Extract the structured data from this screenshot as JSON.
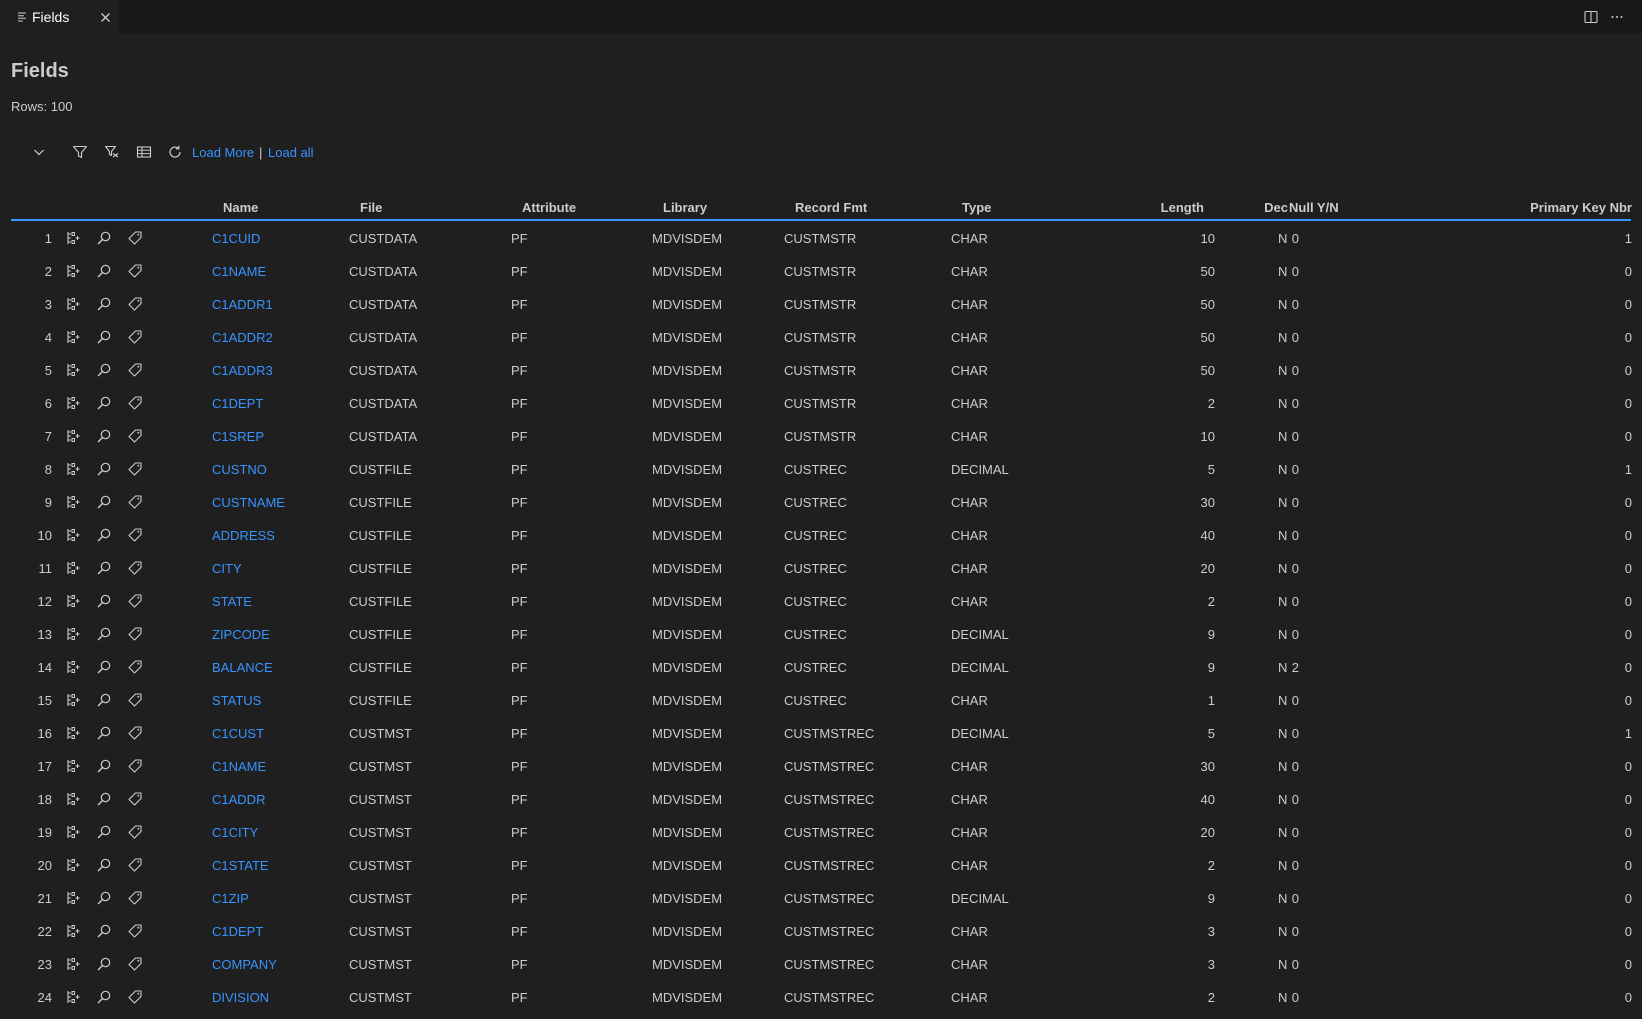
{
  "tab": {
    "label": "Fields"
  },
  "page": {
    "title": "Fields",
    "rows_label": "Rows: 100"
  },
  "toolbar": {
    "load_more": "Load More",
    "separator": "|",
    "load_all": "Load all"
  },
  "columns": {
    "name": "Name",
    "file": "File",
    "attribute": "Attribute",
    "library": "Library",
    "record_fmt": "Record Fmt",
    "type": "Type",
    "length": "Length",
    "dec": "Dec",
    "null_yn": "Null Y/N",
    "primary_key_nbr": "Primary Key Nbr"
  },
  "rows": [
    {
      "n": "1",
      "name": "C1CUID",
      "file": "CUSTDATA",
      "attr": "PF",
      "lib": "MDVISDEM",
      "fmt": "CUSTMSTR",
      "type": "CHAR",
      "len": "10",
      "dec": "0",
      "nul": "N",
      "pk": "1"
    },
    {
      "n": "2",
      "name": "C1NAME",
      "file": "CUSTDATA",
      "attr": "PF",
      "lib": "MDVISDEM",
      "fmt": "CUSTMSTR",
      "type": "CHAR",
      "len": "50",
      "dec": "0",
      "nul": "N",
      "pk": "0"
    },
    {
      "n": "3",
      "name": "C1ADDR1",
      "file": "CUSTDATA",
      "attr": "PF",
      "lib": "MDVISDEM",
      "fmt": "CUSTMSTR",
      "type": "CHAR",
      "len": "50",
      "dec": "0",
      "nul": "N",
      "pk": "0"
    },
    {
      "n": "4",
      "name": "C1ADDR2",
      "file": "CUSTDATA",
      "attr": "PF",
      "lib": "MDVISDEM",
      "fmt": "CUSTMSTR",
      "type": "CHAR",
      "len": "50",
      "dec": "0",
      "nul": "N",
      "pk": "0"
    },
    {
      "n": "5",
      "name": "C1ADDR3",
      "file": "CUSTDATA",
      "attr": "PF",
      "lib": "MDVISDEM",
      "fmt": "CUSTMSTR",
      "type": "CHAR",
      "len": "50",
      "dec": "0",
      "nul": "N",
      "pk": "0"
    },
    {
      "n": "6",
      "name": "C1DEPT",
      "file": "CUSTDATA",
      "attr": "PF",
      "lib": "MDVISDEM",
      "fmt": "CUSTMSTR",
      "type": "CHAR",
      "len": "2",
      "dec": "0",
      "nul": "N",
      "pk": "0"
    },
    {
      "n": "7",
      "name": "C1SREP",
      "file": "CUSTDATA",
      "attr": "PF",
      "lib": "MDVISDEM",
      "fmt": "CUSTMSTR",
      "type": "CHAR",
      "len": "10",
      "dec": "0",
      "nul": "N",
      "pk": "0"
    },
    {
      "n": "8",
      "name": "CUSTNO",
      "file": "CUSTFILE",
      "attr": "PF",
      "lib": "MDVISDEM",
      "fmt": "CUSTREC",
      "type": "DECIMAL",
      "len": "5",
      "dec": "0",
      "nul": "N",
      "pk": "1"
    },
    {
      "n": "9",
      "name": "CUSTNAME",
      "file": "CUSTFILE",
      "attr": "PF",
      "lib": "MDVISDEM",
      "fmt": "CUSTREC",
      "type": "CHAR",
      "len": "30",
      "dec": "0",
      "nul": "N",
      "pk": "0"
    },
    {
      "n": "10",
      "name": "ADDRESS",
      "file": "CUSTFILE",
      "attr": "PF",
      "lib": "MDVISDEM",
      "fmt": "CUSTREC",
      "type": "CHAR",
      "len": "40",
      "dec": "0",
      "nul": "N",
      "pk": "0"
    },
    {
      "n": "11",
      "name": "CITY",
      "file": "CUSTFILE",
      "attr": "PF",
      "lib": "MDVISDEM",
      "fmt": "CUSTREC",
      "type": "CHAR",
      "len": "20",
      "dec": "0",
      "nul": "N",
      "pk": "0"
    },
    {
      "n": "12",
      "name": "STATE",
      "file": "CUSTFILE",
      "attr": "PF",
      "lib": "MDVISDEM",
      "fmt": "CUSTREC",
      "type": "CHAR",
      "len": "2",
      "dec": "0",
      "nul": "N",
      "pk": "0"
    },
    {
      "n": "13",
      "name": "ZIPCODE",
      "file": "CUSTFILE",
      "attr": "PF",
      "lib": "MDVISDEM",
      "fmt": "CUSTREC",
      "type": "DECIMAL",
      "len": "9",
      "dec": "0",
      "nul": "N",
      "pk": "0"
    },
    {
      "n": "14",
      "name": "BALANCE",
      "file": "CUSTFILE",
      "attr": "PF",
      "lib": "MDVISDEM",
      "fmt": "CUSTREC",
      "type": "DECIMAL",
      "len": "9",
      "dec": "2",
      "nul": "N",
      "pk": "0"
    },
    {
      "n": "15",
      "name": "STATUS",
      "file": "CUSTFILE",
      "attr": "PF",
      "lib": "MDVISDEM",
      "fmt": "CUSTREC",
      "type": "CHAR",
      "len": "1",
      "dec": "0",
      "nul": "N",
      "pk": "0"
    },
    {
      "n": "16",
      "name": "C1CUST",
      "file": "CUSTMST",
      "attr": "PF",
      "lib": "MDVISDEM",
      "fmt": "CUSTMSTREC",
      "type": "DECIMAL",
      "len": "5",
      "dec": "0",
      "nul": "N",
      "pk": "1"
    },
    {
      "n": "17",
      "name": "C1NAME",
      "file": "CUSTMST",
      "attr": "PF",
      "lib": "MDVISDEM",
      "fmt": "CUSTMSTREC",
      "type": "CHAR",
      "len": "30",
      "dec": "0",
      "nul": "N",
      "pk": "0"
    },
    {
      "n": "18",
      "name": "C1ADDR",
      "file": "CUSTMST",
      "attr": "PF",
      "lib": "MDVISDEM",
      "fmt": "CUSTMSTREC",
      "type": "CHAR",
      "len": "40",
      "dec": "0",
      "nul": "N",
      "pk": "0"
    },
    {
      "n": "19",
      "name": "C1CITY",
      "file": "CUSTMST",
      "attr": "PF",
      "lib": "MDVISDEM",
      "fmt": "CUSTMSTREC",
      "type": "CHAR",
      "len": "20",
      "dec": "0",
      "nul": "N",
      "pk": "0"
    },
    {
      "n": "20",
      "name": "C1STATE",
      "file": "CUSTMST",
      "attr": "PF",
      "lib": "MDVISDEM",
      "fmt": "CUSTMSTREC",
      "type": "CHAR",
      "len": "2",
      "dec": "0",
      "nul": "N",
      "pk": "0"
    },
    {
      "n": "21",
      "name": "C1ZIP",
      "file": "CUSTMST",
      "attr": "PF",
      "lib": "MDVISDEM",
      "fmt": "CUSTMSTREC",
      "type": "DECIMAL",
      "len": "9",
      "dec": "0",
      "nul": "N",
      "pk": "0"
    },
    {
      "n": "22",
      "name": "C1DEPT",
      "file": "CUSTMST",
      "attr": "PF",
      "lib": "MDVISDEM",
      "fmt": "CUSTMSTREC",
      "type": "CHAR",
      "len": "3",
      "dec": "0",
      "nul": "N",
      "pk": "0"
    },
    {
      "n": "23",
      "name": "COMPANY",
      "file": "CUSTMST",
      "attr": "PF",
      "lib": "MDVISDEM",
      "fmt": "CUSTMSTREC",
      "type": "CHAR",
      "len": "3",
      "dec": "0",
      "nul": "N",
      "pk": "0"
    },
    {
      "n": "24",
      "name": "DIVISION",
      "file": "CUSTMST",
      "attr": "PF",
      "lib": "MDVISDEM",
      "fmt": "CUSTMSTREC",
      "type": "CHAR",
      "len": "2",
      "dec": "0",
      "nul": "N",
      "pk": "0"
    }
  ],
  "colors": {
    "accent": "#3794ff",
    "background": "#1f1f1f",
    "tabbar": "#181818",
    "text": "#cccccc"
  }
}
